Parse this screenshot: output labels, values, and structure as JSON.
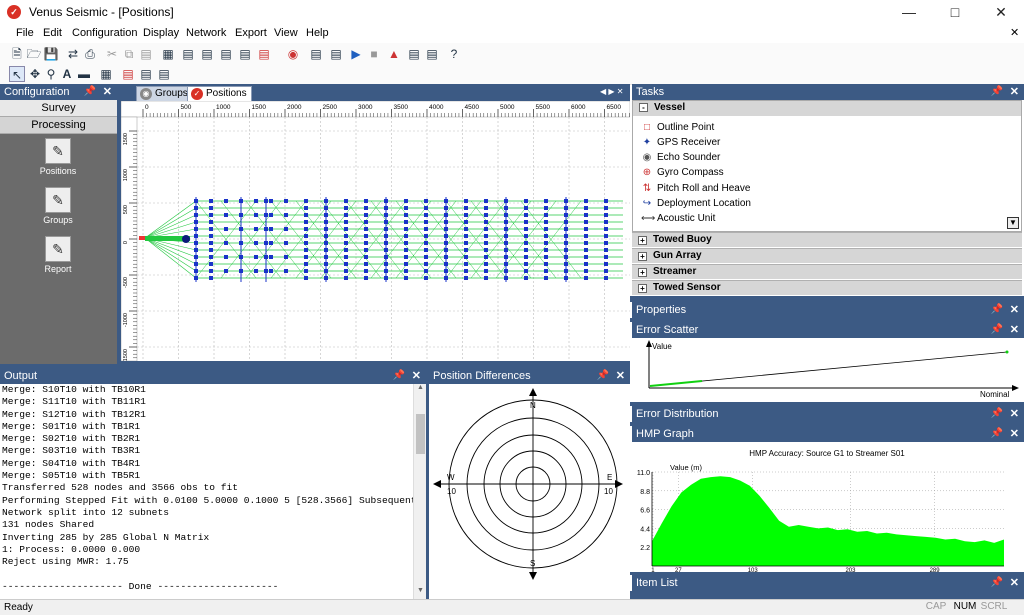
{
  "window": {
    "title": "Venus Seismic - [Positions]",
    "app_icon": "venus-logo-icon"
  },
  "menu": [
    "File",
    "Edit",
    "Configuration",
    "Display",
    "Network",
    "Export",
    "View",
    "Help"
  ],
  "config_panel": {
    "title": "Configuration",
    "nav": [
      "Survey",
      "Processing"
    ],
    "tools": [
      {
        "label": "Positions",
        "icon": "positions-icon"
      },
      {
        "label": "Groups",
        "icon": "groups-icon"
      },
      {
        "label": "Report",
        "icon": "report-icon"
      }
    ]
  },
  "doc_tabs": [
    {
      "label": "Groups",
      "active": false
    },
    {
      "label": "Positions",
      "active": true
    }
  ],
  "ruler": {
    "top_ticks": [
      "0",
      "500",
      "1000",
      "1500",
      "2000",
      "2500",
      "3000",
      "3500",
      "4000",
      "4500",
      "5000",
      "5500",
      "6000",
      "6500"
    ],
    "left_ticks": [
      "1500",
      "1000",
      "500",
      "0",
      "-500",
      "-1000",
      "-1500"
    ]
  },
  "tasks": {
    "title": "Tasks",
    "vessel_header": "Vessel",
    "items": [
      {
        "label": "Outline Point",
        "icon": "outline-point-icon"
      },
      {
        "label": "GPS Receiver",
        "icon": "gps-receiver-icon"
      },
      {
        "label": "Echo Sounder",
        "icon": "echo-sounder-icon"
      },
      {
        "label": "Gyro Compass",
        "icon": "gyro-compass-icon"
      },
      {
        "label": "Pitch Roll and Heave",
        "icon": "pitch-roll-heave-icon"
      },
      {
        "label": "Deployment Location",
        "icon": "deployment-location-icon"
      },
      {
        "label": "Acoustic Unit",
        "icon": "acoustic-unit-icon"
      }
    ],
    "groups": [
      "Towed Buoy",
      "Gun Array",
      "Streamer",
      "Towed Sensor"
    ]
  },
  "panels": {
    "properties": "Properties",
    "error_scatter": "Error Scatter",
    "error_distribution": "Error Distribution",
    "hmp_graph": "HMP Graph",
    "item_list": "Item List",
    "output": "Output",
    "position_differences": "Position Differences"
  },
  "error_scatter": {
    "y_label": "Value",
    "x_label": "Nominal"
  },
  "hmp_graph": {
    "title": "HMP Accuracy: Source G1 to Streamer S01",
    "y_label": "Value (m)",
    "y_ticks": [
      "11.0",
      "8.8",
      "6.6",
      "4.4",
      "2.2"
    ],
    "x_ticks": [
      "1",
      "27",
      "103",
      "203",
      "289"
    ],
    "fill_color": "#00ff00"
  },
  "chart_data": {
    "type": "area",
    "title": "HMP Accuracy: Source G1 to Streamer S01",
    "ylabel": "Value (m)",
    "ylim": [
      0,
      11.0
    ],
    "x": [
      0,
      10,
      20,
      30,
      40,
      50,
      60,
      70,
      80,
      90,
      100,
      110,
      120,
      130,
      140,
      150,
      160,
      170,
      180,
      190,
      200,
      210,
      220,
      230,
      240,
      250,
      260,
      270,
      280,
      290,
      300,
      310,
      320,
      330,
      340,
      350,
      360
    ],
    "values": [
      2.9,
      5.0,
      7.0,
      8.6,
      9.5,
      10.2,
      10.4,
      10.5,
      10.4,
      10.0,
      9.4,
      8.2,
      6.8,
      5.3,
      4.6,
      4.8,
      4.6,
      4.4,
      4.5,
      4.2,
      4.3,
      4.0,
      4.1,
      3.8,
      3.9,
      3.7,
      3.6,
      3.5,
      3.4,
      3.3,
      3.1,
      3.2,
      2.9,
      2.8,
      3.0,
      2.7,
      3.1
    ],
    "color": "#00ff00"
  },
  "position_differences": {
    "n": "N",
    "s": "S",
    "e": "E",
    "w": "W",
    "e_val": "10",
    "w_val": "10"
  },
  "output_lines": [
    "Merge: S10T10 with TB10R1",
    "Merge: S11T10 with TB11R1",
    "Merge: S12T10 with TB12R1",
    "Merge: S01T10 with TB1R1",
    "Merge: S02T10 with TB2R1",
    "Merge: S03T10 with TB3R1",
    "Merge: S04T10 with TB4R1",
    "Merge: S05T10 with TB5R1",
    "Transferred 528 nodes and 3566 obs to fit",
    "Performing Stepped Fit with 0.0100 5.0000 0.1000 5 [528.3566] Subsequent",
    "Network split into 12 subnets",
    "131 nodes Shared",
    "Inverting 285 by 285 Global N Matrix",
    "1: Process: 0.0000 0.000",
    "Reject using MWR: 1.75",
    "",
    "--------------------- Done ---------------------"
  ],
  "status": {
    "text": "Ready",
    "cap": "CAP",
    "num": "NUM",
    "scrl": "SCRL"
  },
  "colors": {
    "panel_header": "#3c5a84",
    "node_blue": "#1a33c8",
    "link_green": "#22c840"
  }
}
